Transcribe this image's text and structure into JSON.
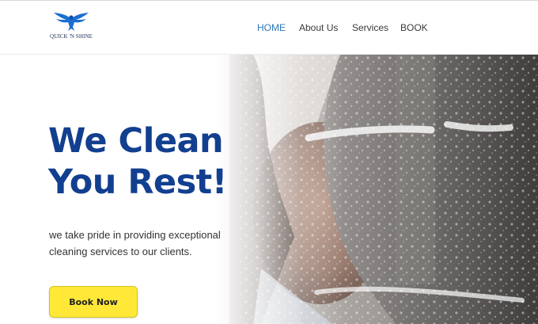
{
  "brand": {
    "logo_text": "QUICK 'N SHINE",
    "logo_icon": "eagle-icon",
    "color": "#1a6fd1"
  },
  "nav": {
    "items": [
      {
        "label": "HOME",
        "active": true
      },
      {
        "label": "About Us",
        "active": false
      },
      {
        "label": "Services",
        "active": false
      },
      {
        "label": "BOOK",
        "active": false
      }
    ]
  },
  "hero": {
    "headline_line1": "We Clean",
    "headline_line2": "You Rest!",
    "tagline_line1": "we take pride in providing exceptional",
    "tagline_line2": "cleaning services to our clients.",
    "cta_label": "Book Now"
  },
  "colors": {
    "headline": "#123f8f",
    "nav_active": "#2f78b5",
    "cta_background": "#ffe838"
  }
}
